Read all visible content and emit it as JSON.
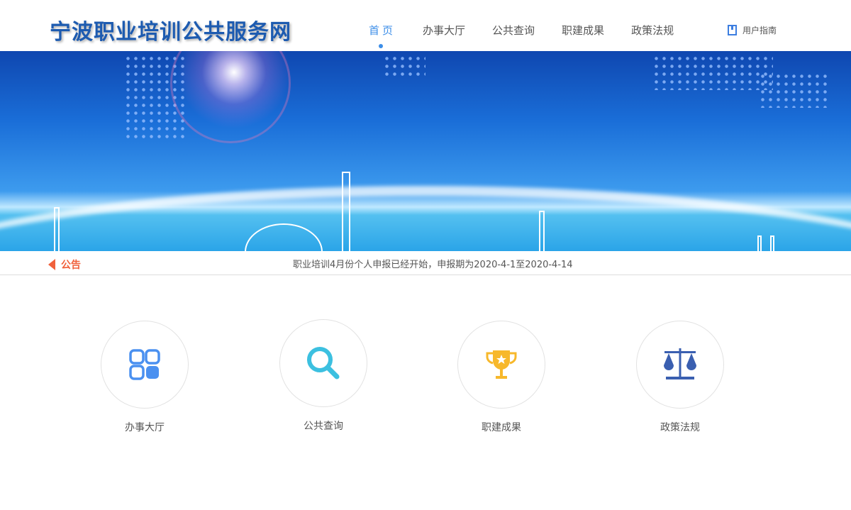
{
  "header": {
    "logo": "宁波职业培训公共服务网",
    "nav": [
      {
        "label": "首页"
      },
      {
        "label": "办事大厅"
      },
      {
        "label": "公共查询"
      },
      {
        "label": "职建成果"
      },
      {
        "label": "政策法规"
      }
    ],
    "guide": {
      "label": "用户指南",
      "icon": "book-icon"
    }
  },
  "notice": {
    "label": "公告",
    "icon": "speaker-icon",
    "text": "职业培训4月份个人申报已经开始，申报期为2020-4-1至2020-4-14"
  },
  "cards": [
    {
      "label": "办事大厅",
      "icon": "grid-icon",
      "color": "#4a90f0"
    },
    {
      "label": "公共查询",
      "icon": "search-icon",
      "color": "#3cc0e0"
    },
    {
      "label": "职建成果",
      "icon": "trophy-icon",
      "color": "#f7b82b"
    },
    {
      "label": "政策法规",
      "icon": "scales-icon",
      "color": "#3a5fb0"
    }
  ]
}
